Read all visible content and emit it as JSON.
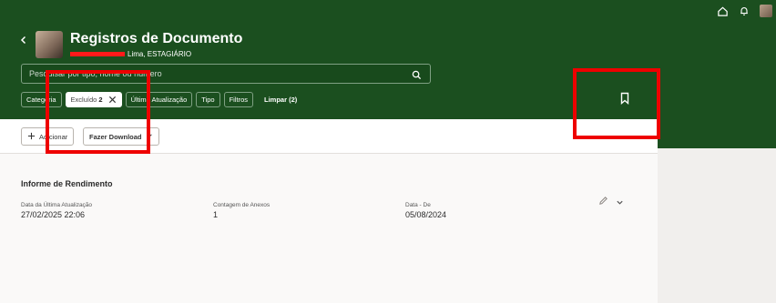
{
  "header": {
    "title": "Registros de Documento",
    "subtitle_suffix": "Lima, ESTAGIÁRIO",
    "color": "#1b4f1f"
  },
  "top_icons": [
    "home-icon",
    "bell-icon",
    "user-avatar"
  ],
  "search": {
    "placeholder": "Pesquisar por tipo, nome ou número"
  },
  "filters": {
    "chips": [
      {
        "label": "Categoria"
      },
      {
        "label": "Excluído",
        "count": "2",
        "active": true
      },
      {
        "label": "Última Atualização"
      },
      {
        "label": "Tipo"
      },
      {
        "label": "Filtros"
      }
    ],
    "clear_label": "Limpar (2)"
  },
  "toolbar": {
    "add_label": "Adicionar",
    "download_label": "Fazer Download"
  },
  "record": {
    "title": "Informe de Rendimento",
    "fields": [
      {
        "label": "Data da Última Atualização",
        "value": "27/02/2025 22:06"
      },
      {
        "label": "Contagem de Anexos",
        "value": "1"
      },
      {
        "label": "Data - De",
        "value": "05/08/2024"
      }
    ]
  },
  "colors": {
    "highlight": "#ee0000",
    "content_bg": "#faf9f8"
  }
}
